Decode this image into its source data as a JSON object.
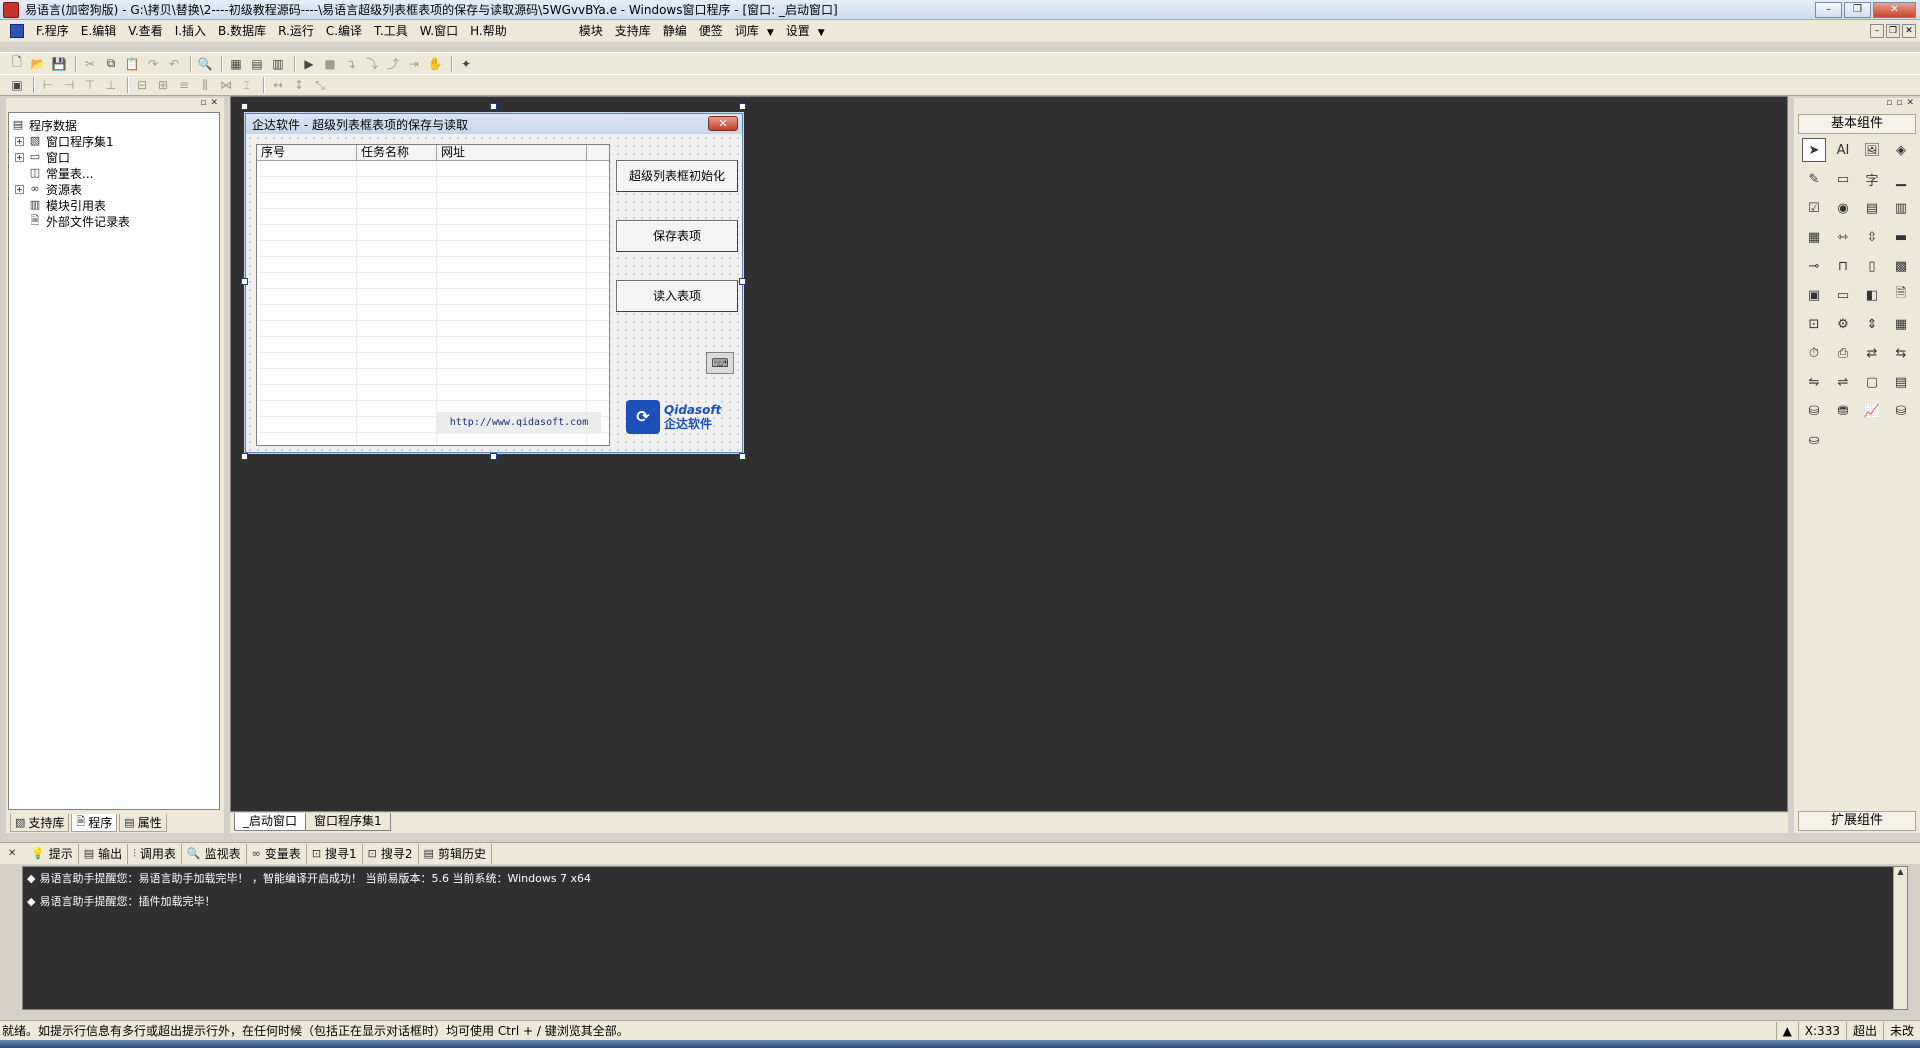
{
  "window": {
    "title": "易语言(加密狗版) - G:\\拷贝\\替换\\2----初级教程源码----\\易语言超级列表框表项的保存与读取源码\\5WGvvBYa.e - Windows窗口程序 - [窗口: _启动窗口]",
    "controls": {
      "minimize": "–",
      "restore": "❐",
      "close": "✕"
    }
  },
  "menubar": {
    "items": [
      "F.程序",
      "E.编辑",
      "V.查看",
      "I.插入",
      "B.数据库",
      "R.运行",
      "C.编译",
      "T.工具",
      "W.窗口",
      "H.帮助"
    ],
    "extra": [
      "模块",
      "支持库",
      "静编",
      "便签",
      "词库",
      "设置"
    ],
    "dropdown_arrow": "▼"
  },
  "left_panel": {
    "tree": [
      {
        "label": "程序数据",
        "expander": "",
        "icon": "database-icon",
        "level": 0
      },
      {
        "label": "窗口程序集1",
        "expander": "+",
        "icon": "module-icon",
        "level": 1
      },
      {
        "label": "窗口",
        "expander": "+",
        "icon": "window-icon",
        "level": 1
      },
      {
        "label": "常量表...",
        "expander": "",
        "icon": "constants-icon",
        "level": 1
      },
      {
        "label": "资源表",
        "expander": "+",
        "icon": "resource-icon",
        "level": 1
      },
      {
        "label": "模块引用表",
        "expander": "",
        "icon": "module-ref-icon",
        "level": 1
      },
      {
        "label": "外部文件记录表",
        "expander": "",
        "icon": "file-record-icon",
        "level": 1
      }
    ],
    "tabs": [
      "支持库",
      "程序",
      "属性"
    ]
  },
  "form": {
    "title": "企达软件 - 超级列表框表项的保存与读取",
    "columns": [
      "序号",
      "任务名称",
      "网址"
    ],
    "buttons": [
      "超级列表框初始化",
      "保存表项",
      "读入表项"
    ],
    "url_label": "http://www.qidasoft.com",
    "logo_en": "Qidasoft",
    "logo_cn": "企达软件"
  },
  "design_tabs": [
    "_启动窗口",
    "窗口程序集1"
  ],
  "right_panel": {
    "title": "基本组件",
    "footer": "扩展组件",
    "selected_tool": "pointer-tool-icon",
    "label_tool_glyph": "AI",
    "text_tool_glyph": "字"
  },
  "output": {
    "tabs": [
      "提示",
      "输出",
      "调用表",
      "监视表",
      "变量表",
      "搜寻1",
      "搜寻2",
      "剪辑历史"
    ],
    "lines": [
      "易语言助手提醒您：易语言助手加载完毕！ ，智能编译开启成功！ 当前易版本：5.6  当前系统：Windows 7 x64",
      "易语言助手提醒您：插件加载完毕！"
    ],
    "bullet": "◆"
  },
  "statusbar": {
    "text": "就绪。如提示行信息有多行或超出提示行外，在任何时候（包括正在显示对话框时）均可使用 Ctrl + / 键浏览其全部。",
    "coord": "X:333",
    "mode": "超出",
    "modified": "未改"
  }
}
